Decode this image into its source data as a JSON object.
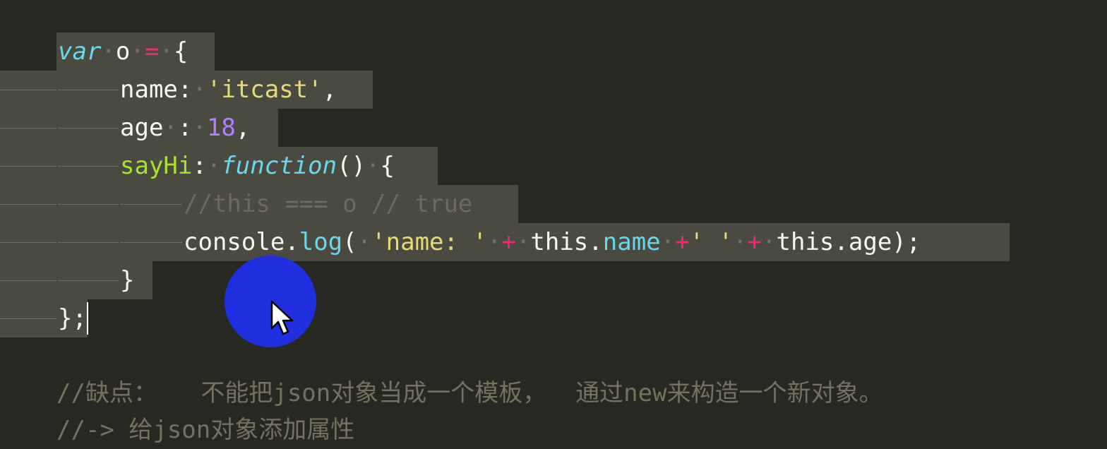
{
  "code": {
    "line1": {
      "kw": "var",
      "name": "o",
      "op": "=",
      "brace": "{"
    },
    "line2": {
      "key": "name:",
      "value": "'itcast'",
      "tail": ","
    },
    "line3": {
      "key": "age",
      "colon": ":",
      "value": "18",
      "tail": ","
    },
    "line4": {
      "key": "sayHi",
      "colon": ":",
      "kw": "function",
      "paren": "()",
      "brace": "{"
    },
    "line5": {
      "comment": "//this === o // true"
    },
    "line6": {
      "obj": "console",
      "dot": ".",
      "method": "log",
      "open": "(",
      "str1": "'name: '",
      "plus1": "+",
      "this1": "this",
      "prop1": "name",
      "plus2": "+",
      "str2": "' '",
      "plus3": "+",
      "this2": "this",
      "prop2": "age",
      "close": ");"
    },
    "line7": {
      "brace": "}"
    },
    "line8": {
      "close": "};"
    }
  },
  "comments": {
    "c1": "//缺点：   不能把json对象当成一个模板，  通过new来构造一个新对象。",
    "c2": "//-> 给json对象添加属性"
  },
  "colors": {
    "background": "#272822",
    "selection": "#4a4a40",
    "keyword": "#66d9ef",
    "operator": "#f92672",
    "string": "#e6db74",
    "number": "#ae81ff",
    "function_name": "#a6e22e",
    "comment": "#75715e",
    "click_indicator": "#1f2fe0"
  },
  "icons": {
    "pointer": "mouse-pointer-icon",
    "click": "click-indicator"
  }
}
